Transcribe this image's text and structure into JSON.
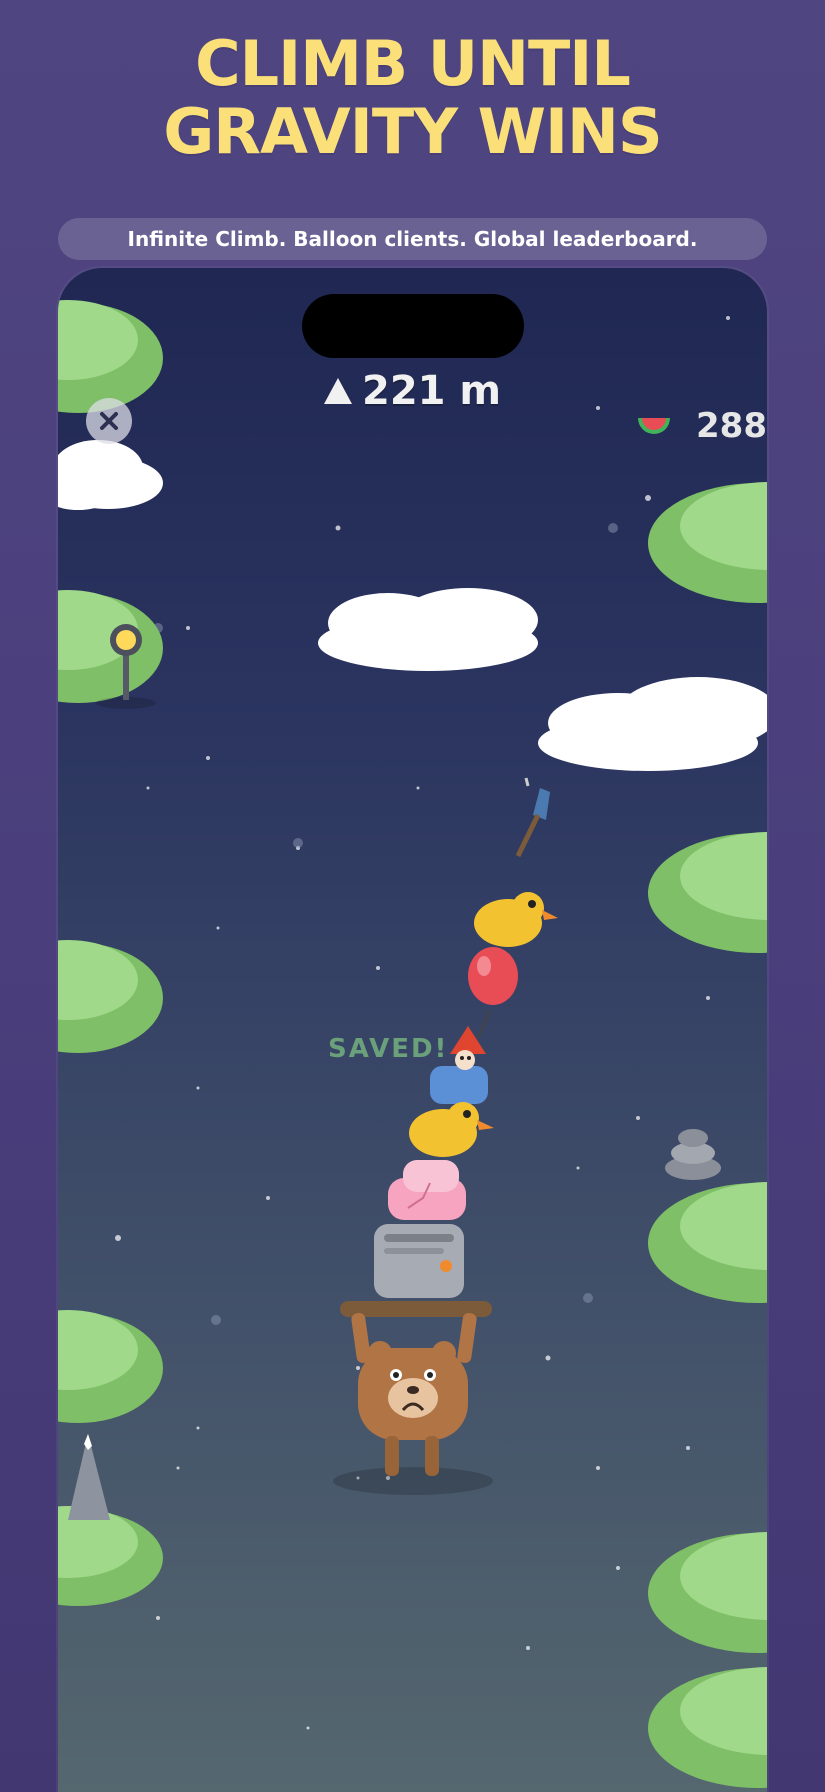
{
  "headline": {
    "line1": "CLIMB UNTIL",
    "line2": "GRAVITY WINS"
  },
  "tagline": "Infinite Climb. Balloon clients. Global leaderboard.",
  "hud": {
    "height_value": "221 m",
    "coins": "288"
  },
  "status_popup": "SAVED!",
  "colors": {
    "headline": "#fbe07a",
    "background": "#4a3f7c",
    "grass": "#8ccf72",
    "sky_top": "#1f2752"
  }
}
